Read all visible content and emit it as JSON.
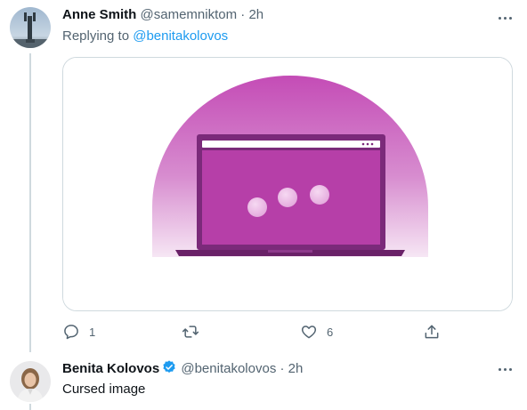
{
  "colors": {
    "link": "#1d9bf0",
    "secondary_text": "#536471",
    "media_purple": "#b63fa8"
  },
  "tweet1": {
    "name": "Anne Smith",
    "handle": "@samemniktom",
    "separator": "·",
    "time": "2h",
    "replying_prefix": "Replying to ",
    "replying_handle": "@benitakolovos",
    "media_icon": "laptop-loading-illustration",
    "actions": {
      "reply_count": "1",
      "retweet_count": "",
      "like_count": "6"
    }
  },
  "tweet2": {
    "name": "Benita Kolovos",
    "verified": true,
    "handle": "@benitakolovos",
    "separator": "·",
    "time": "2h",
    "text": "Cursed image"
  }
}
